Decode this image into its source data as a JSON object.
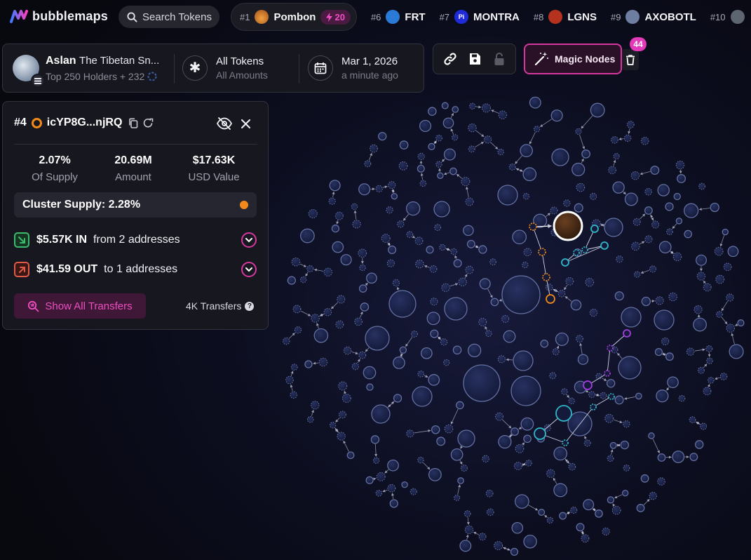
{
  "app": {
    "name": "bubblemaps"
  },
  "search": {
    "label": "Search Tokens"
  },
  "ticker": {
    "featured": {
      "rank": "#1",
      "name": "Pombon",
      "boost": "20"
    },
    "items": [
      {
        "rank": "#6",
        "name": "FRT",
        "icon": "frt-token-icon",
        "color": "#2b7bd6",
        "glyph": ""
      },
      {
        "rank": "#7",
        "name": "MONTRA",
        "icon": "montra-token-icon",
        "color": "#1f2bd8",
        "glyph": "Pi"
      },
      {
        "rank": "#8",
        "name": "LGNS",
        "icon": "lgns-token-icon",
        "color": "#b5321f",
        "glyph": ""
      },
      {
        "rank": "#9",
        "name": "AXOBOTL",
        "icon": "axobotl-token-icon",
        "color": "#6d7ea0",
        "glyph": ""
      },
      {
        "rank": "#10",
        "name": "",
        "icon": "token-icon",
        "color": "#5d6670",
        "glyph": ""
      }
    ]
  },
  "token": {
    "symbol": "Aslan",
    "full_name": "The Tibetan Sn...",
    "holders": "Top 250 Holders + 232",
    "filter_title": "All Tokens",
    "filter_sub": "All Amounts",
    "date_title": "Mar 1, 2026",
    "date_sub": "a minute ago"
  },
  "magic": {
    "label": "Magic Nodes",
    "count": "44"
  },
  "wallet": {
    "rank": "#4",
    "address": "icYP8G...njRQ",
    "stats": [
      {
        "value": "2.07%",
        "label": "Of Supply"
      },
      {
        "value": "20.69M",
        "label": "Amount"
      },
      {
        "value": "$17.63K",
        "label": "USD Value"
      }
    ],
    "cluster": "Cluster Supply: 2.28%",
    "in_amount": "$5.57K IN",
    "in_text": "from 2 addresses",
    "out_amount": "$41.59 OUT",
    "out_text": "to 1 addresses",
    "show_transfers": "Show All Transfers",
    "transfers_count": "4K Transfers",
    "help": "?"
  },
  "colors": {
    "accent_pink": "#d6379f",
    "selected_orange": "#f28a1b",
    "cluster_cyan": "#2fb9c9",
    "cluster_purple": "#a43de0",
    "bubble": "#4a5a8a",
    "in_green": "#3dbb6d",
    "out_red": "#e05a4a"
  }
}
